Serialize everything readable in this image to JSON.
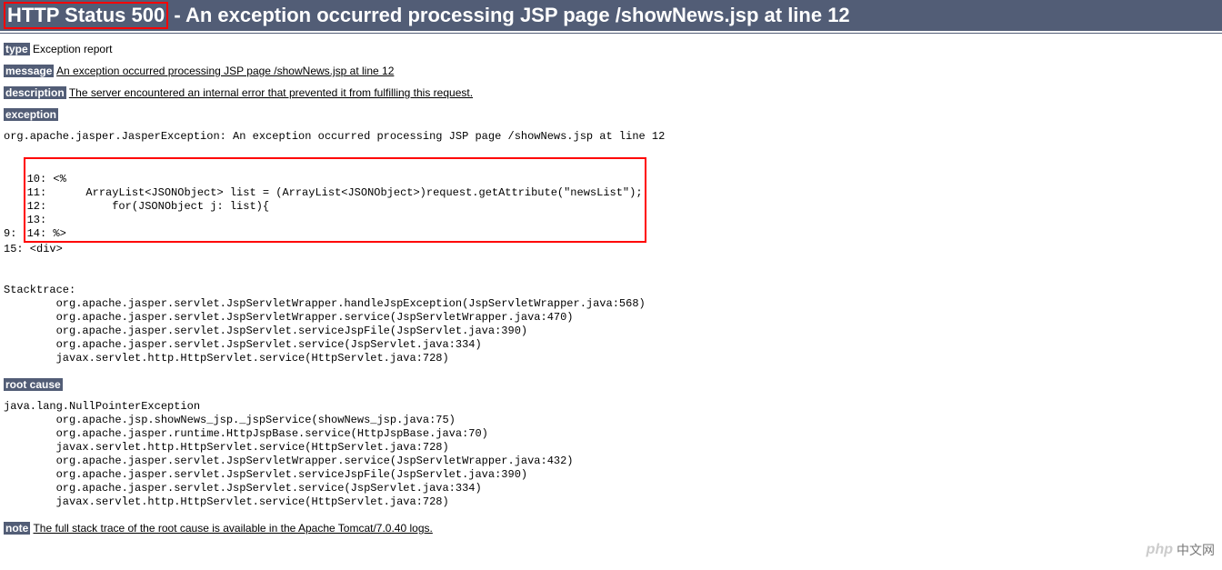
{
  "header": {
    "status": "HTTP Status 500",
    "title_rest": " - An exception occurred processing JSP page /showNews.jsp at line 12"
  },
  "type": {
    "label": "type",
    "value": " Exception report"
  },
  "message": {
    "label": "message",
    "value": "An exception occurred processing JSP page /showNews.jsp at line 12"
  },
  "description": {
    "label": "description",
    "value": "The server encountered an internal error that prevented it from fulfilling this request."
  },
  "exception": {
    "label": "exception",
    "pre_text": "org.apache.jasper.JasperException: An exception occurred processing JSP page /showNews.jsp at line 12\n\n9: ",
    "code_box": "\n10: <%\n11:      ArrayList<JSONObject> list = (ArrayList<JSONObject>)request.getAttribute(\"newsList\");\n12:          for(JSONObject j: list){\n13:         \n14: %>",
    "post_text": "\n15: <div>\n\n\nStacktrace:\n\torg.apache.jasper.servlet.JspServletWrapper.handleJspException(JspServletWrapper.java:568)\n\torg.apache.jasper.servlet.JspServletWrapper.service(JspServletWrapper.java:470)\n\torg.apache.jasper.servlet.JspServlet.serviceJspFile(JspServlet.java:390)\n\torg.apache.jasper.servlet.JspServlet.service(JspServlet.java:334)\n\tjavax.servlet.http.HttpServlet.service(HttpServlet.java:728)"
  },
  "root_cause": {
    "label": "root cause",
    "text": "java.lang.NullPointerException\n\torg.apache.jsp.showNews_jsp._jspService(showNews_jsp.java:75)\n\torg.apache.jasper.runtime.HttpJspBase.service(HttpJspBase.java:70)\n\tjavax.servlet.http.HttpServlet.service(HttpServlet.java:728)\n\torg.apache.jasper.servlet.JspServletWrapper.service(JspServletWrapper.java:432)\n\torg.apache.jasper.servlet.JspServlet.serviceJspFile(JspServlet.java:390)\n\torg.apache.jasper.servlet.JspServlet.service(JspServlet.java:334)\n\tjavax.servlet.http.HttpServlet.service(HttpServlet.java:728)"
  },
  "note": {
    "label": "note",
    "value": "The full stack trace of the root cause is available in the Apache Tomcat/7.0.40 logs."
  },
  "watermark": {
    "php": "php",
    "text": "中文网"
  }
}
